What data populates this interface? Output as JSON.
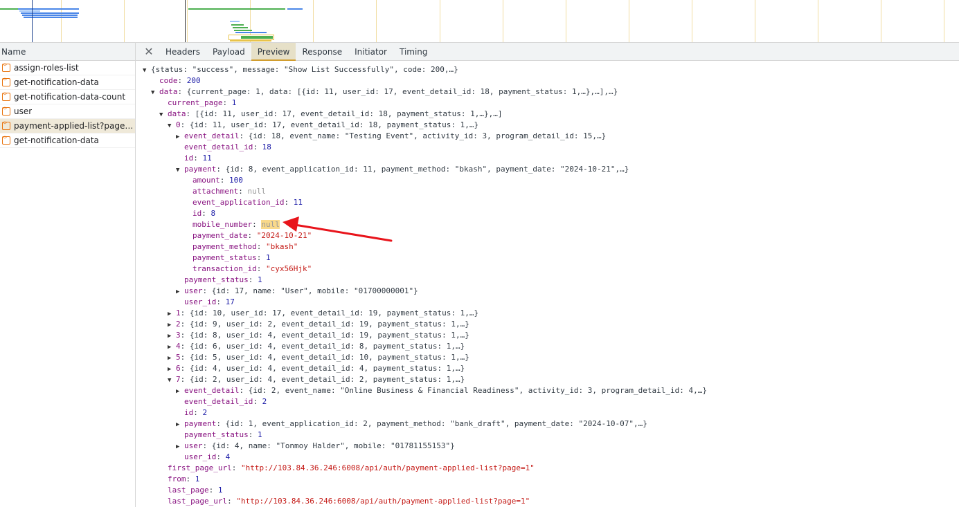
{
  "name_panel": {
    "header": "Name",
    "requests": [
      {
        "label": "assign-roles-list",
        "selected": false
      },
      {
        "label": "get-notification-data",
        "selected": false
      },
      {
        "label": "get-notification-data-count",
        "selected": false
      },
      {
        "label": "user",
        "selected": false
      },
      {
        "label": "payment-applied-list?page=1...",
        "selected": true
      },
      {
        "label": "get-notification-data",
        "selected": false
      }
    ]
  },
  "tabs": {
    "close": "✕",
    "items": [
      "Headers",
      "Payload",
      "Preview",
      "Response",
      "Initiator",
      "Timing"
    ],
    "active": "Preview"
  },
  "preview": {
    "root": "{status: \"success\", message: \"Show List Successfully\", code: 200,…}",
    "code": "200",
    "data_summary": "{current_page: 1, data: [{id: 11, user_id: 17, event_detail_id: 18, payment_status: 1,…},…],…}",
    "current_page": "1",
    "data_list_summary": "[{id: 11, user_id: 17, event_detail_id: 18, payment_status: 1,…},…]",
    "item0_summary": "{id: 11, user_id: 17, event_detail_id: 18, payment_status: 1,…}",
    "item0_event_detail": "{id: 18, event_name: \"Testing Event\", activity_id: 3, program_detail_id: 15,…}",
    "item0_event_detail_id": "18",
    "item0_id": "11",
    "item0_payment_summary": "{id: 8, event_application_id: 11, payment_method: \"bkash\", payment_date: \"2024-10-21\",…}",
    "payment_amount": "100",
    "payment_attachment": "null",
    "payment_event_application_id": "11",
    "payment_id": "8",
    "payment_mobile_number": "null",
    "payment_date": "\"2024-10-21\"",
    "payment_method": "\"bkash\"",
    "payment_status_val": "1",
    "payment_transaction_id": "\"cyx56Hjk\"",
    "item0_payment_status": "1",
    "item0_user": "{id: 17, name: \"User\", mobile: \"01700000001\"}",
    "item0_user_id": "17",
    "item1": "{id: 10, user_id: 17, event_detail_id: 19, payment_status: 1,…}",
    "item2": "{id: 9, user_id: 2, event_detail_id: 19, payment_status: 1,…}",
    "item3": "{id: 8, user_id: 4, event_detail_id: 19, payment_status: 1,…}",
    "item4": "{id: 6, user_id: 4, event_detail_id: 8, payment_status: 1,…}",
    "item5": "{id: 5, user_id: 4, event_detail_id: 10, payment_status: 1,…}",
    "item6": "{id: 4, user_id: 4, event_detail_id: 4, payment_status: 1,…}",
    "item7_summary": "{id: 2, user_id: 4, event_detail_id: 2, payment_status: 1,…}",
    "item7_event_detail": "{id: 2, event_name: \"Online Business & Financial Readiness\", activity_id: 3, program_detail_id: 4,…}",
    "item7_event_detail_id": "2",
    "item7_id": "2",
    "item7_payment": "{id: 1, event_application_id: 2, payment_method: \"bank_draft\", payment_date: \"2024-10-07\",…}",
    "item7_payment_status": "1",
    "item7_user": "{id: 4, name: \"Tonmoy Halder\", mobile: \"01781155153\"}",
    "item7_user_id": "4",
    "first_page_url": "\"http://103.84.36.246:6008/api/auth/payment-applied-list?page=1\"",
    "from": "1",
    "last_page": "1",
    "last_page_url": "\"http://103.84.36.246:6008/api/auth/payment-applied-list?page=1\""
  },
  "colors": {
    "accent_tab": "#d19d2e",
    "arrow": "#e8141b",
    "highlight": "#f9d98b"
  }
}
